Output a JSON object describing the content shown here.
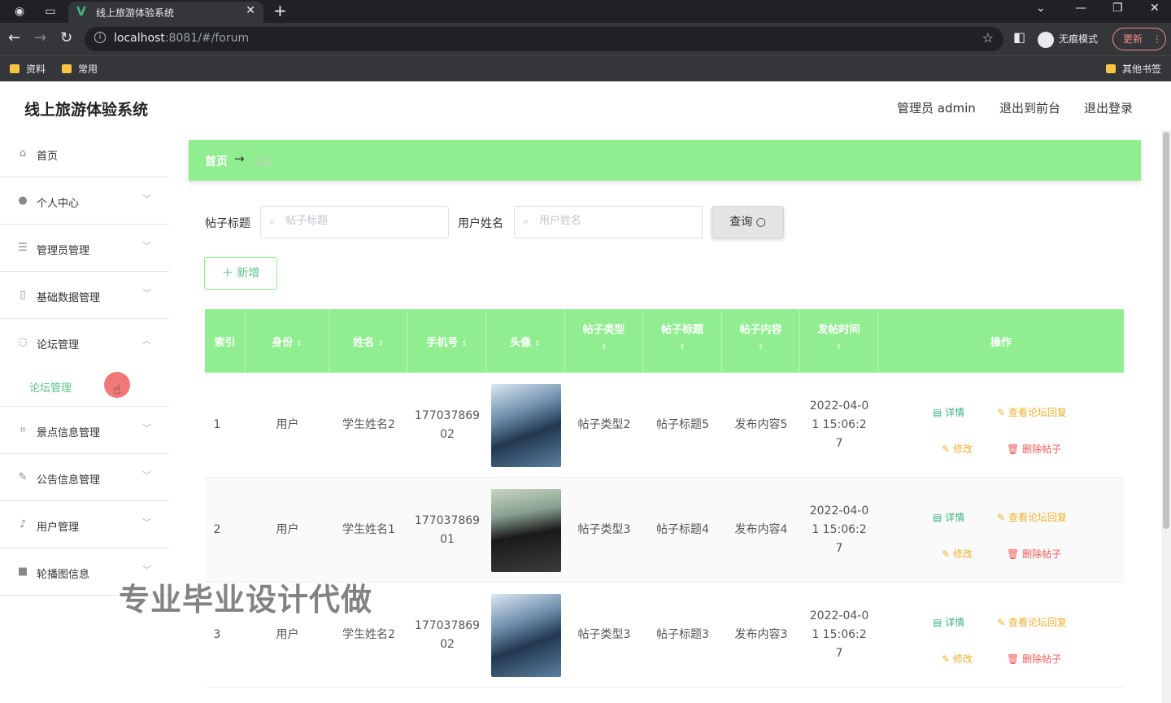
{
  "browser": {
    "tab_title": "线上旅游体验系统",
    "url_host": "localhost",
    "url_path": ":8081/#/forum",
    "incognito_label": "无痕模式",
    "update_label": "更新",
    "bookmarks": [
      "资料",
      "常用"
    ],
    "other_bookmarks": "其他书签"
  },
  "header": {
    "title": "线上旅游体验系统",
    "user": "管理员 admin",
    "to_front": "退出到前台",
    "logout": "退出登录"
  },
  "sidebar": {
    "items": [
      {
        "label": "首页",
        "icon": "home-icon",
        "glyph": "⌂"
      },
      {
        "label": "个人中心",
        "icon": "user-icon",
        "glyph": "●"
      },
      {
        "label": "管理员管理",
        "icon": "stack-icon",
        "glyph": "☰"
      },
      {
        "label": "基础数据管理",
        "icon": "phone-icon",
        "glyph": "▯"
      },
      {
        "label": "论坛管理",
        "icon": "chat-icon",
        "glyph": "◌"
      },
      {
        "label": "景点信息管理",
        "icon": "crop-icon",
        "glyph": "⌗"
      },
      {
        "label": "公告信息管理",
        "icon": "edit-icon",
        "glyph": "✎"
      },
      {
        "label": "用户管理",
        "icon": "mic-icon",
        "glyph": "♪"
      },
      {
        "label": "轮播图信息",
        "icon": "video-icon",
        "glyph": "■"
      }
    ],
    "sub_item": "论坛管理"
  },
  "watermark": "专业毕业设计代做",
  "breadcrumb": {
    "home": "首页",
    "arrow": "→",
    "current": "论坛"
  },
  "filters": {
    "title_label": "帖子标题",
    "title_placeholder": "帖子标题",
    "user_label": "用户姓名",
    "user_placeholder": "用户姓名",
    "query_button": "查询 ○",
    "add_button": "＋ 新增"
  },
  "table": {
    "headers": [
      "索引",
      "身份",
      "姓名",
      "手机号",
      "头像",
      "帖子类型",
      "帖子标题",
      "帖子内容",
      "发帖时间",
      "操作"
    ],
    "actions": {
      "detail": "详情",
      "reply": "查看论坛回复",
      "edit": "修改",
      "delete": "删除帖子"
    },
    "rows": [
      {
        "index": "1",
        "role": "用户",
        "name": "学生姓名2",
        "phone": "17703786902",
        "type": "帖子类型2",
        "title": "帖子标题5",
        "content": "发布内容5",
        "time": "2022-04-01 15:06:27"
      },
      {
        "index": "2",
        "role": "用户",
        "name": "学生姓名1",
        "phone": "17703786901",
        "type": "帖子类型3",
        "title": "帖子标题4",
        "content": "发布内容4",
        "time": "2022-04-01 15:06:27"
      },
      {
        "index": "3",
        "role": "用户",
        "name": "学生姓名2",
        "phone": "17703786902",
        "type": "帖子类型3",
        "title": "帖子标题3",
        "content": "发布内容3",
        "time": "2022-04-01 15:06:27"
      }
    ]
  },
  "colors": {
    "accent": "#90ee90",
    "link_green": "#5bc48a",
    "warn": "#f0b030",
    "danger": "#f05a5a"
  }
}
